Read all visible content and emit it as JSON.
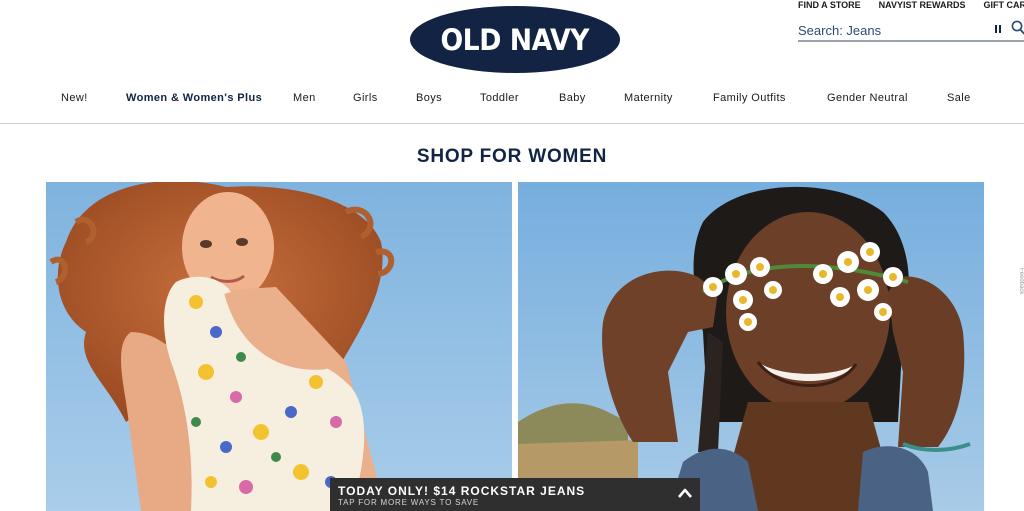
{
  "brand": {
    "logo_text": "OLD NAVY",
    "navy": "#122344"
  },
  "utility_links": {
    "find_store": "FIND A STORE",
    "navyist_rewards": "NAVYIST REWARDS",
    "gift_card": "GIFT CARD"
  },
  "search": {
    "text": "Search: Jeans"
  },
  "nav": {
    "items": [
      {
        "label": "New!"
      },
      {
        "label": "Women & Women's Plus"
      },
      {
        "label": "Men"
      },
      {
        "label": "Girls"
      },
      {
        "label": "Boys"
      },
      {
        "label": "Toddler"
      },
      {
        "label": "Baby"
      },
      {
        "label": "Maternity"
      },
      {
        "label": "Family Outfits"
      },
      {
        "label": "Gender Neutral"
      },
      {
        "label": "Sale"
      }
    ],
    "active_index": 1
  },
  "main": {
    "title": "SHOP FOR WOMEN"
  },
  "side_tab": {
    "label": "Feedback"
  },
  "promo": {
    "title": "TODAY ONLY! $14 ROCKSTAR JEANS",
    "subtitle": "TAP FOR MORE WAYS TO SAVE",
    "bg_color": "#2f2f2f"
  },
  "icons": {
    "search": "search-icon",
    "pause": "pause-icon",
    "expand": "chevron-up-icon"
  }
}
